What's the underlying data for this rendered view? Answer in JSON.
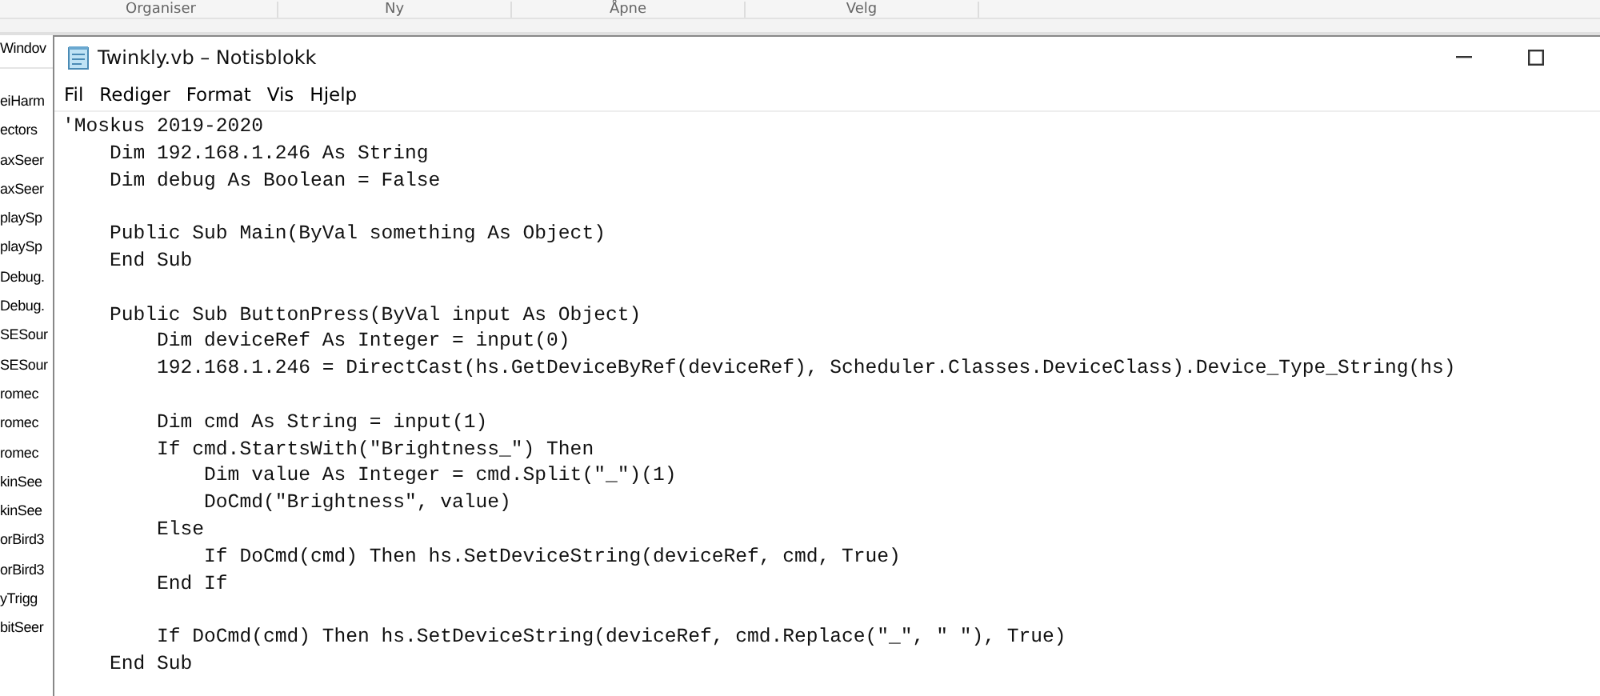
{
  "background_window": {
    "toolbar": [
      "Organiser",
      "Ny",
      "Åpne",
      "Velg"
    ],
    "address_label": "Windov",
    "file_list": [
      "eiHarm",
      "ectors",
      "axSeer",
      "axSeer",
      "playSp",
      "playSp",
      "Debug.",
      "Debug.",
      "SESour",
      "SESour",
      "romec",
      "romec",
      "romec",
      "kinSee",
      "kinSee",
      "orBird3",
      "orBird3",
      "yTrigg",
      "bitSeer"
    ]
  },
  "window": {
    "title": "Twinkly.vb – Notisblokk"
  },
  "menu": [
    "Fil",
    "Rediger",
    "Format",
    "Vis",
    "Hjelp"
  ],
  "editor": {
    "text": "'Moskus 2019-2020\n    Dim 192.168.1.246 As String\n    Dim debug As Boolean = False\n\n    Public Sub Main(ByVal something As Object)\n    End Sub\n\n    Public Sub ButtonPress(ByVal input As Object)\n        Dim deviceRef As Integer = input(0)\n        192.168.1.246 = DirectCast(hs.GetDeviceByRef(deviceRef), Scheduler.Classes.DeviceClass).Device_Type_String(hs)\n\n        Dim cmd As String = input(1)\n        If cmd.StartsWith(\"Brightness_\") Then\n            Dim value As Integer = cmd.Split(\"_\")(1)\n            DoCmd(\"Brightness\", value)\n        Else\n            If DoCmd(cmd) Then hs.SetDeviceString(deviceRef, cmd, True)\n        End If\n\n        If DoCmd(cmd) Then hs.SetDeviceString(deviceRef, cmd.Replace(\"_\", \" \"), True)\n    End Sub"
  }
}
